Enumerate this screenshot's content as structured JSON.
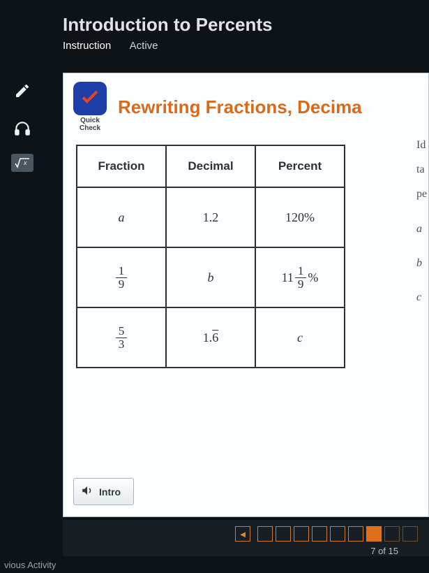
{
  "header": {
    "title": "Introduction to Percents",
    "tabs": [
      "Instruction",
      "Active"
    ],
    "active_tab_index": 0
  },
  "sidebar": {
    "items": [
      {
        "name": "pencil-icon"
      },
      {
        "name": "headphones-icon"
      },
      {
        "name": "sqrt-icon"
      }
    ]
  },
  "quick_check": {
    "label_line1": "Quick",
    "label_line2": "Check"
  },
  "lesson_title": "Rewriting Fractions, Decima",
  "table": {
    "headers": [
      "Fraction",
      "Decimal",
      "Percent"
    ],
    "rows": [
      {
        "fraction": {
          "type": "var",
          "value": "a"
        },
        "decimal": "1.2",
        "percent": "120%"
      },
      {
        "fraction": {
          "type": "frac",
          "num": "1",
          "den": "9"
        },
        "decimal": {
          "type": "var",
          "value": "b"
        },
        "percent": {
          "type": "mixed_pct",
          "whole": "11",
          "num": "1",
          "den": "9"
        }
      },
      {
        "fraction": {
          "type": "frac",
          "num": "5",
          "den": "3"
        },
        "decimal": {
          "type": "repeating",
          "whole": "1.",
          "repeat": "6"
        },
        "percent": {
          "type": "var",
          "value": "c"
        }
      }
    ]
  },
  "right_text": {
    "lines": [
      "Id",
      "ta",
      "pe",
      "a",
      "b",
      "c"
    ]
  },
  "intro_button": "Intro",
  "footer": {
    "counter": "7 of 15",
    "squares_filled_index": 6,
    "squares_total": 9
  },
  "prev_activity": "vious Activity"
}
